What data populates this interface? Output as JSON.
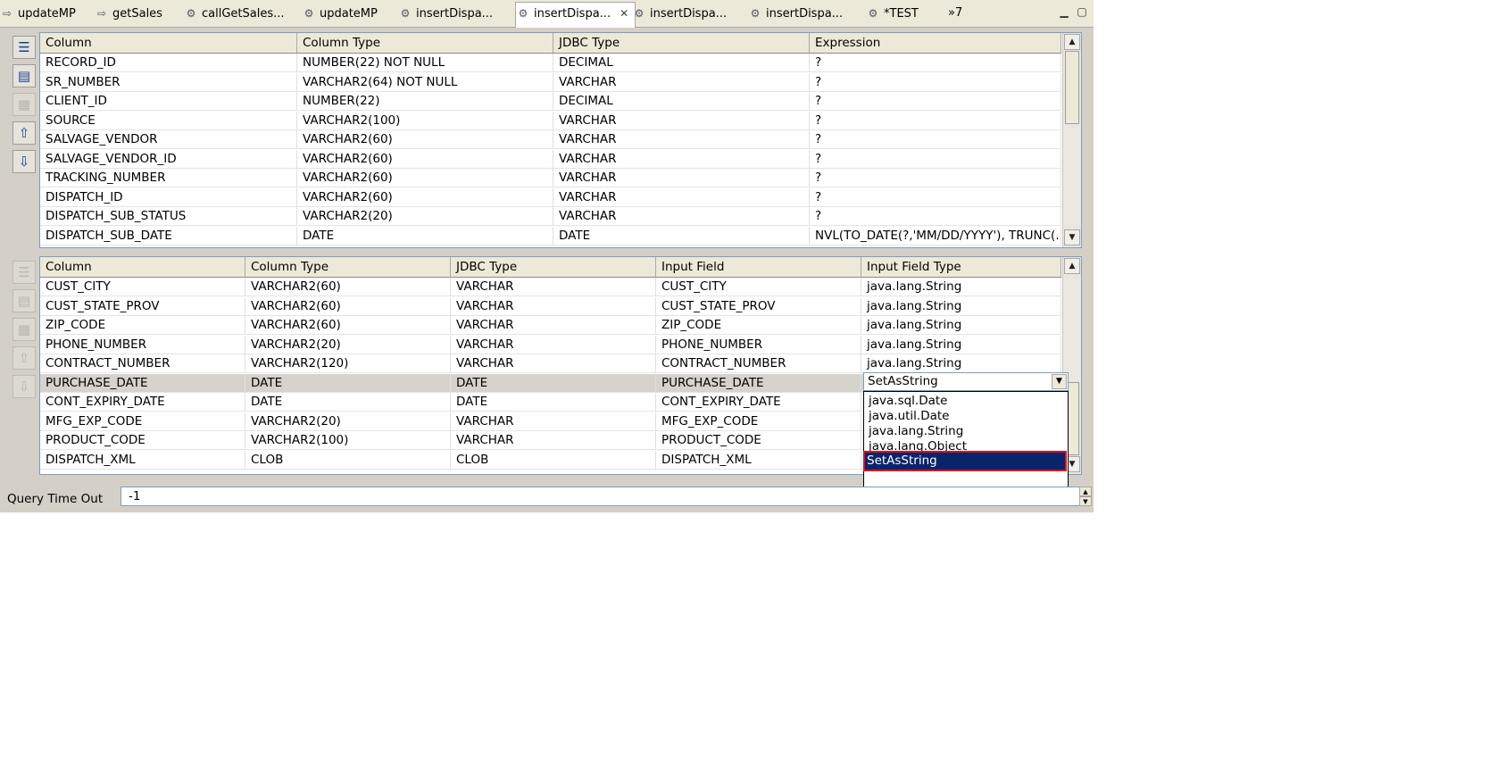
{
  "tabs": [
    {
      "label": "updateMP",
      "icon": "arrow-icon"
    },
    {
      "label": "getSales",
      "icon": "arrow-icon"
    },
    {
      "label": "callGetSales...",
      "icon": "service-icon"
    },
    {
      "label": "updateMP",
      "icon": "service-icon"
    },
    {
      "label": "insertDispa...",
      "icon": "service-icon"
    },
    {
      "label": "insertDispa...",
      "icon": "service-icon",
      "active": true
    },
    {
      "label": "insertDispa...",
      "icon": "service-icon"
    },
    {
      "label": "insertDispa...",
      "icon": "service-icon"
    },
    {
      "label": "*TEST",
      "icon": "service-icon"
    }
  ],
  "overflow_label": "»7",
  "top_table": {
    "headers": [
      "Column",
      "Column Type",
      "JDBC Type",
      "Expression"
    ],
    "rows": [
      [
        "RECORD_ID",
        "NUMBER(22) NOT NULL",
        "DECIMAL",
        "?"
      ],
      [
        "SR_NUMBER",
        "VARCHAR2(64) NOT NULL",
        "VARCHAR",
        "?"
      ],
      [
        "CLIENT_ID",
        "NUMBER(22)",
        "DECIMAL",
        "?"
      ],
      [
        "SOURCE",
        "VARCHAR2(100)",
        "VARCHAR",
        "?"
      ],
      [
        "SALVAGE_VENDOR",
        "VARCHAR2(60)",
        "VARCHAR",
        "?"
      ],
      [
        "SALVAGE_VENDOR_ID",
        "VARCHAR2(60)",
        "VARCHAR",
        "?"
      ],
      [
        "TRACKING_NUMBER",
        "VARCHAR2(60)",
        "VARCHAR",
        "?"
      ],
      [
        "DISPATCH_ID",
        "VARCHAR2(60)",
        "VARCHAR",
        "?"
      ],
      [
        "DISPATCH_SUB_STATUS",
        "VARCHAR2(20)",
        "VARCHAR",
        "?"
      ],
      [
        "DISPATCH_SUB_DATE",
        "DATE",
        "DATE",
        "NVL(TO_DATE(?,'MM/DD/YYYY'), TRUNC(..."
      ]
    ]
  },
  "bottom_table": {
    "headers": [
      "Column",
      "Column Type",
      "JDBC Type",
      "Input Field",
      "Input Field Type"
    ],
    "rows": [
      [
        "CUST_CITY",
        "VARCHAR2(60)",
        "VARCHAR",
        "CUST_CITY",
        "java.lang.String"
      ],
      [
        "CUST_STATE_PROV",
        "VARCHAR2(60)",
        "VARCHAR",
        "CUST_STATE_PROV",
        "java.lang.String"
      ],
      [
        "ZIP_CODE",
        "VARCHAR2(60)",
        "VARCHAR",
        "ZIP_CODE",
        "java.lang.String"
      ],
      [
        "PHONE_NUMBER",
        "VARCHAR2(20)",
        "VARCHAR",
        "PHONE_NUMBER",
        "java.lang.String"
      ],
      [
        "CONTRACT_NUMBER",
        "VARCHAR2(120)",
        "VARCHAR",
        "CONTRACT_NUMBER",
        "java.lang.String"
      ],
      [
        "PURCHASE_DATE",
        "DATE",
        "DATE",
        "PURCHASE_DATE",
        ""
      ],
      [
        "CONT_EXPIRY_DATE",
        "DATE",
        "DATE",
        "CONT_EXPIRY_DATE",
        ""
      ],
      [
        "MFG_EXP_CODE",
        "VARCHAR2(20)",
        "VARCHAR",
        "MFG_EXP_CODE",
        ""
      ],
      [
        "PRODUCT_CODE",
        "VARCHAR2(100)",
        "VARCHAR",
        "PRODUCT_CODE",
        ""
      ],
      [
        "DISPATCH_XML",
        "CLOB",
        "CLOB",
        "DISPATCH_XML",
        ""
      ]
    ]
  },
  "combo": {
    "value": "SetAsString",
    "options": [
      "java.sql.Date",
      "java.util.Date",
      "java.lang.String",
      "java.lang.Object",
      "SetAsString"
    ],
    "highlighted": "SetAsString"
  },
  "query_timeout": {
    "label": "Query Time Out",
    "value": "-1"
  }
}
